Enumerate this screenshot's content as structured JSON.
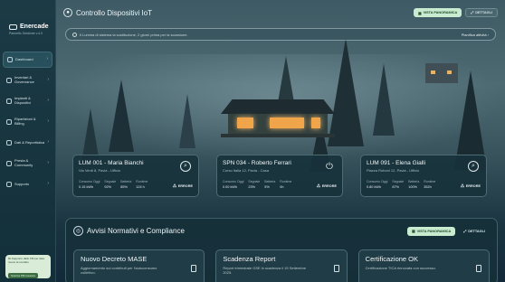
{
  "brand": {
    "name": "Enercade",
    "subtitle": "Pannello Gestione v.4.0"
  },
  "sidebar": {
    "items": [
      {
        "label": "Dashboard",
        "active": true
      },
      {
        "label": "Inventari & Governance"
      },
      {
        "label": "Impianti & Dispositivi"
      },
      {
        "label": "Ripartizioni & Billing"
      },
      {
        "label": "Dati & Reportistica"
      },
      {
        "label": "Presta & Community"
      },
      {
        "label": "Supporto"
      }
    ],
    "promo": {
      "text": "Ri-Supporto dallo FM per dare nuove al contatto",
      "button": "Scarica PM creature"
    }
  },
  "header": {
    "title": "Controllo Dispositivi IoT",
    "btn_overview": "VISTA PANORAMICA",
    "btn_details": "DETTAGLI"
  },
  "notice": {
    "text": "Il Lumina di sistema la sostituzione, 2 giorni prima per la scansione.",
    "link": "Pianifica attività"
  },
  "devices": [
    {
      "title": "LUM 001 - Maria Bianchi",
      "subtitle": "Via Verdi 8, Pavia - Ufficio",
      "icon": "lamp-icon",
      "metrics": [
        {
          "label": "Consumo Oggi",
          "value": "0.15 kWh"
        },
        {
          "label": "Segnale",
          "value": "92%"
        },
        {
          "label": "Batteria",
          "value": "85%"
        },
        {
          "label": "Runtime",
          "value": "124 h"
        }
      ],
      "status": "ERRORE"
    },
    {
      "title": "SPN 034 - Roberto Ferrari",
      "subtitle": "Corso Italia 12, Pavia - Casa",
      "icon": "plug-icon",
      "metrics": [
        {
          "label": "Consumo Oggi",
          "value": "0.00 kWh"
        },
        {
          "label": "Segnale",
          "value": "23%"
        },
        {
          "label": "Batteria",
          "value": "5%"
        },
        {
          "label": "Runtime",
          "value": "0h"
        }
      ],
      "status": "ERRORE"
    },
    {
      "title": "LUM 091 - Elena Gialli",
      "subtitle": "Piazza Roboni 12, Pavia - Ufficio",
      "icon": "lamp-icon",
      "metrics": [
        {
          "label": "Consumo Oggi",
          "value": "0.80 kWh"
        },
        {
          "label": "Segnale",
          "value": "87%"
        },
        {
          "label": "Batteria",
          "value": "100%"
        },
        {
          "label": "Runtime",
          "value": "352h"
        }
      ],
      "status": "ERRORE"
    }
  ],
  "compliance": {
    "title": "Avvisi Normativi e Compliance",
    "btn_overview": "VISTA PANORAMICA",
    "btn_details": "DETTAGLI",
    "cards": [
      {
        "title": "Nuovo Decreto MASE",
        "desc": "Aggiornamento sui contributi per l'autoconsumo collettivo."
      },
      {
        "title": "Scadenza Report",
        "desc": "Report trimestrale GSE in scadenza il 15 Settembre 2025."
      },
      {
        "title": "Certificazione OK",
        "desc": "Certificazione TICA rinnovata con successo."
      }
    ]
  }
}
